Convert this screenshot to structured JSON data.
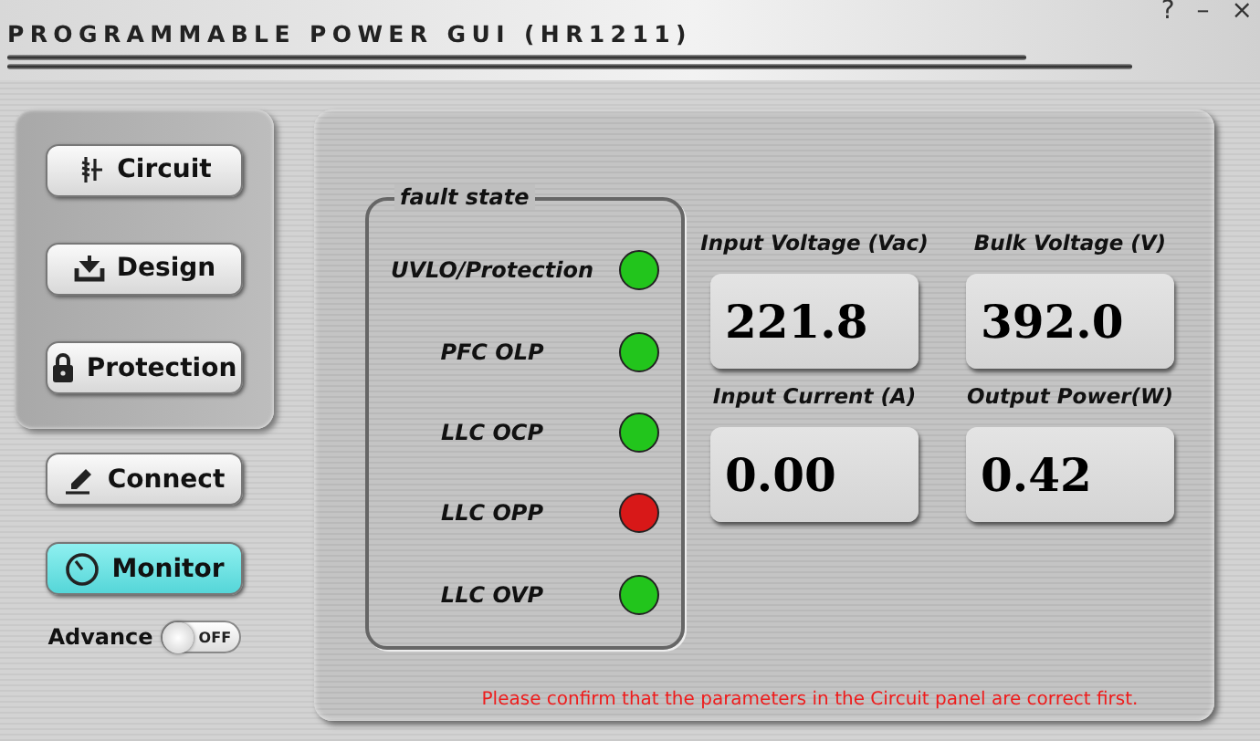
{
  "window": {
    "title": "PROGRAMMABLE POWER GUI (HR1211)",
    "controls": [
      "?",
      "–",
      "×"
    ]
  },
  "nav": [
    {
      "label": "Circuit",
      "selected": false
    },
    {
      "label": "Design",
      "selected": false
    },
    {
      "label": "Protection",
      "selected": false
    }
  ],
  "actions": [
    {
      "label": "Connect",
      "selected": false
    },
    {
      "label": "Monitor",
      "selected": true
    }
  ],
  "advance": {
    "label": "Advance",
    "on": false,
    "state_text": "OFF"
  },
  "fault_state": {
    "title": "fault state",
    "items": [
      {
        "label": "UVLO/Protection",
        "color": "#22c51c"
      },
      {
        "label": "PFC OLP",
        "color": "#22c51c"
      },
      {
        "label": "LLC OCP",
        "color": "#22c51c"
      },
      {
        "label": "LLC OPP",
        "color": "#d81818"
      },
      {
        "label": "LLC OVP",
        "color": "#22c51c"
      }
    ]
  },
  "readings": [
    {
      "label": "Input Voltage (Vac)",
      "value": "221.8"
    },
    {
      "label": "Bulk Voltage (V)",
      "value": "392.0"
    },
    {
      "label": "Input Current (A)",
      "value": "0.00"
    },
    {
      "label": "Output Power(W)",
      "value": "0.42"
    }
  ],
  "message": "Please confirm that the parameters in the Circuit panel are correct first."
}
